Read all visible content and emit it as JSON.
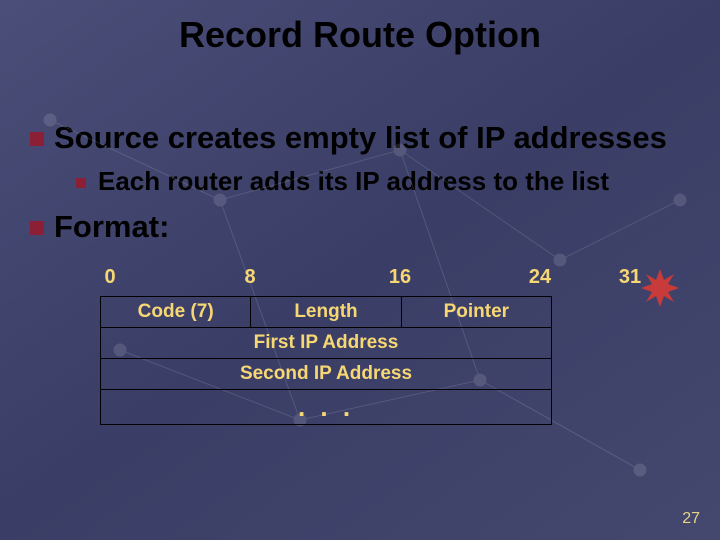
{
  "title": "Record Route Option",
  "bullet1": "Source creates empty list of IP addresses",
  "bullet2": "Each router adds its IP address to the list",
  "bullet3": "Format:",
  "scale": {
    "t0": "0",
    "t8": "8",
    "t16": "16",
    "t24": "24",
    "t31": "31"
  },
  "table": {
    "r0c0": "Code (7)",
    "r0c1": "Length",
    "r0c2": "Pointer",
    "r1": "First IP Address",
    "r2": "Second IP Address",
    "r3": ". . ."
  },
  "page": "27",
  "chart_data": {
    "type": "table",
    "title": "Record Route Option format",
    "bit_offsets": [
      0,
      8,
      16,
      24,
      31
    ],
    "rows": [
      {
        "fields": [
          {
            "name": "Code (7)",
            "bits_start": 0,
            "bits_end": 7
          },
          {
            "name": "Length",
            "bits_start": 8,
            "bits_end": 15
          },
          {
            "name": "Pointer",
            "bits_start": 16,
            "bits_end": 23
          }
        ]
      },
      {
        "fields": [
          {
            "name": "First IP Address",
            "bits_start": 0,
            "bits_end": 31
          }
        ]
      },
      {
        "fields": [
          {
            "name": "Second IP Address",
            "bits_start": 0,
            "bits_end": 31
          }
        ]
      },
      {
        "fields": [
          {
            "name": ". . .",
            "bits_start": 0,
            "bits_end": 31
          }
        ]
      }
    ]
  }
}
